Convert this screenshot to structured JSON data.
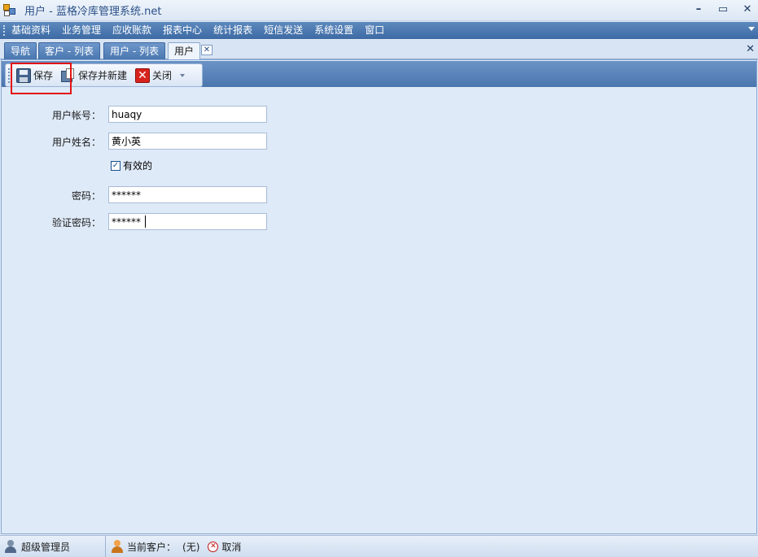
{
  "window": {
    "title": "用户 - 蓝格冷库管理系统.net",
    "minimize": "–",
    "maximize": "▭",
    "close": "✕"
  },
  "menu": {
    "items": [
      "基础资料",
      "业务管理",
      "应收账款",
      "报表中心",
      "统计报表",
      "短信发送",
      "系统设置",
      "窗口"
    ]
  },
  "tabs": {
    "items": [
      {
        "label": "导航"
      },
      {
        "label": "客户 - 列表"
      },
      {
        "label": "用户 - 列表"
      },
      {
        "label": "用户"
      }
    ],
    "close_glyph": "✕",
    "doc_close": "✕"
  },
  "toolbar": {
    "save_label": "保存",
    "save_new_label": "保存并新建",
    "close_label": "关闭",
    "close_glyph": "✕"
  },
  "form": {
    "account_label": "用户帐号：",
    "account_value": "huaqy",
    "name_label": "用户姓名：",
    "name_value": "黄小英",
    "active_label": "有效的",
    "active_checked": true,
    "password_label": "密码：",
    "password_value": "******",
    "confirm_label": "验证密码：",
    "confirm_value": "******"
  },
  "status": {
    "user": "超级管理员",
    "customer_label": "当前客户：",
    "customer_value": "(无)",
    "cancel_label": "取消",
    "cancel_glyph": "✕"
  },
  "colors": {
    "menu_bar": "#4a77b0",
    "highlight": "#e31414",
    "close_icon": "#d8231d"
  }
}
